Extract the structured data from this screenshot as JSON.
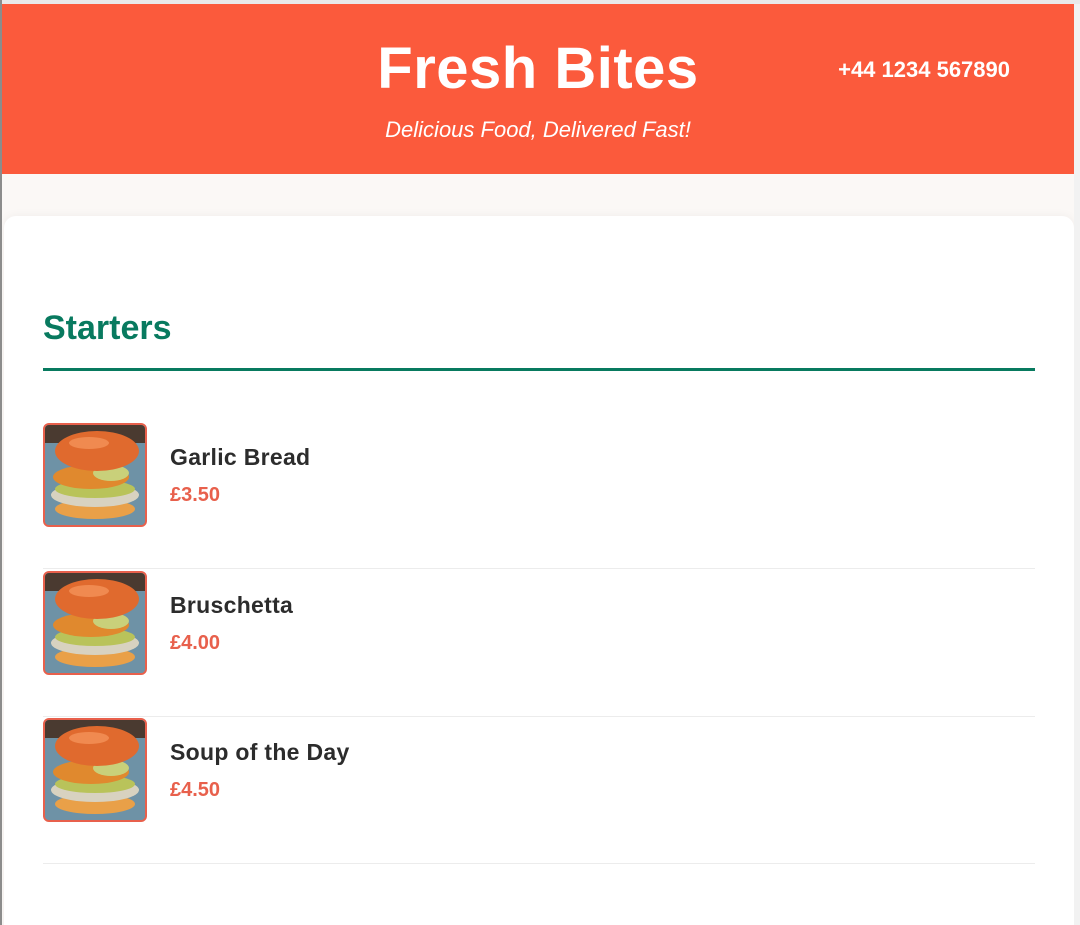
{
  "header": {
    "title": "Fresh Bites",
    "tagline": "Delicious Food, Delivered Fast!",
    "phone": "+44 1234 567890"
  },
  "menu": {
    "section_title": "Starters",
    "items": [
      {
        "name": "Garlic Bread",
        "price": "£3.50",
        "image_icon": "burger-photo"
      },
      {
        "name": "Bruschetta",
        "price": "£4.00",
        "image_icon": "burger-photo"
      },
      {
        "name": "Soup of the Day",
        "price": "£4.50",
        "image_icon": "burger-photo"
      }
    ]
  },
  "colors": {
    "brand": "#fb5a3c",
    "section_accent": "#087a5f",
    "price": "#e8604c",
    "text": "#2c2c2c"
  }
}
